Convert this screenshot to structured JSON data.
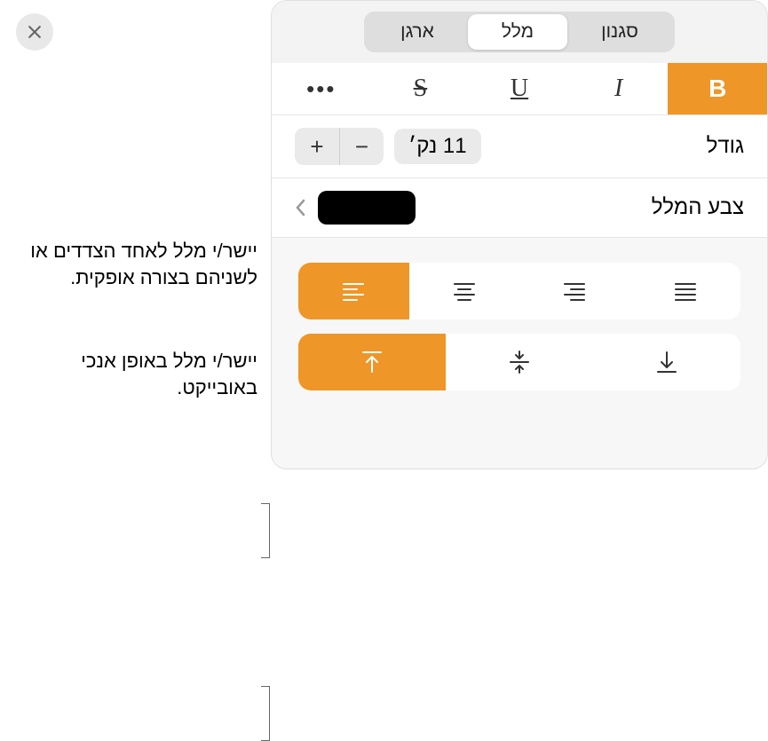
{
  "header": {
    "tabs": [
      {
        "label": "סגנון",
        "active": false
      },
      {
        "label": "מלל",
        "active": true
      },
      {
        "label": "ארגן",
        "active": false
      }
    ]
  },
  "format": {
    "bold": "B",
    "italic": "I",
    "underline": "U",
    "strike": "S",
    "more": "•••"
  },
  "size": {
    "label": "גודל",
    "value": "11 נק׳",
    "minus": "−",
    "plus": "+"
  },
  "color": {
    "label": "צבע המלל",
    "value": "#000000"
  },
  "annotations": {
    "horizontal": "יישר/י מלל לאחד הצדדים או לשניהם בצורה אופקית.",
    "vertical": "יישר/י מלל באופן אנכי באובייקט."
  }
}
